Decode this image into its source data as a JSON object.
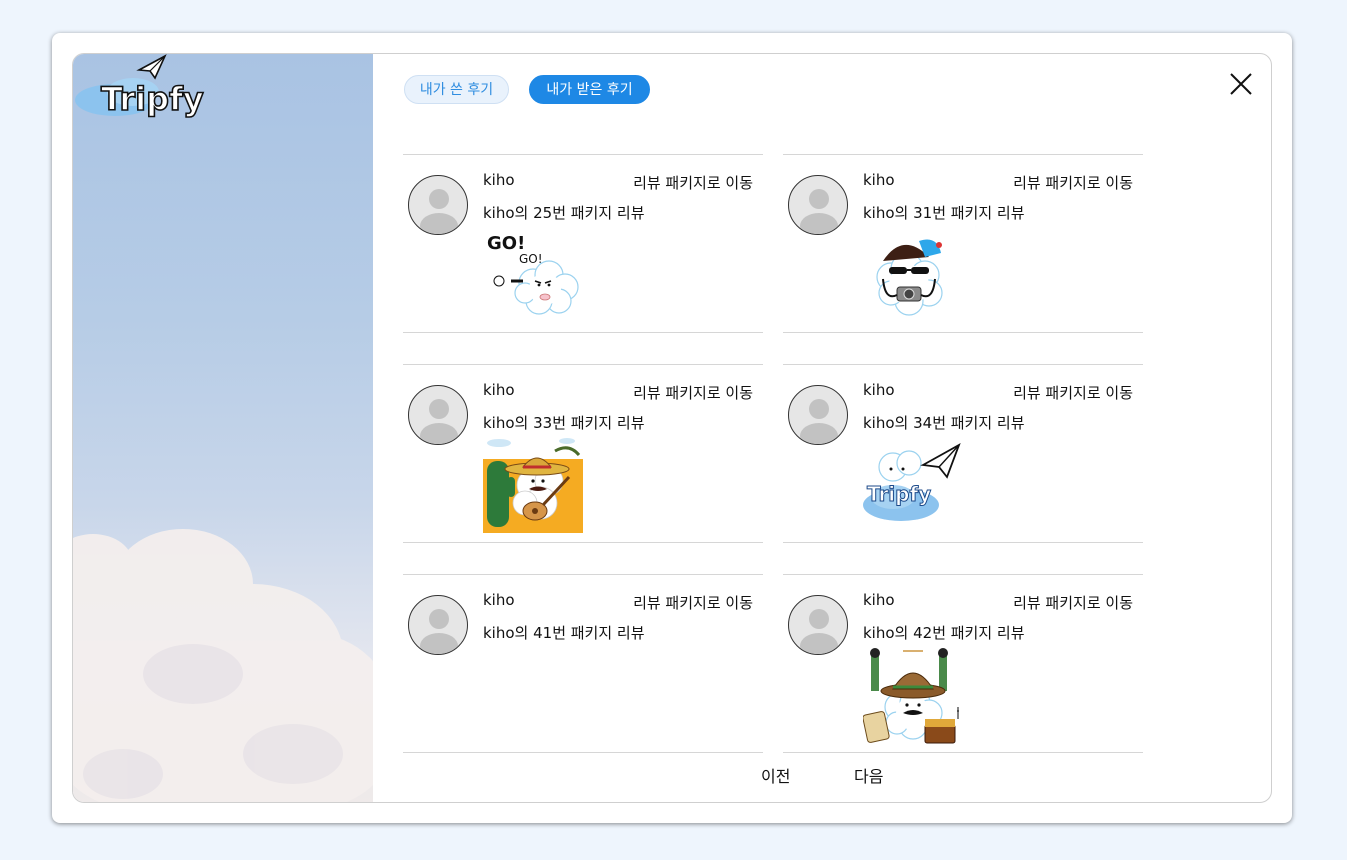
{
  "brand": {
    "logo_text": "Tripfy"
  },
  "tabs": {
    "written": "내가 쓴 후기",
    "received": "내가 받은 후기"
  },
  "reviews": [
    {
      "user": "kiho",
      "goto": "리뷰 패키지로 이동",
      "title": "kiho의 25번 패키지 리뷰",
      "sticker_text_1": "GO!",
      "sticker_text_2": "GO!"
    },
    {
      "user": "kiho",
      "goto": "리뷰 패키지로 이동",
      "title": "kiho의 31번 패키지 리뷰"
    },
    {
      "user": "kiho",
      "goto": "리뷰 패키지로 이동",
      "title": "kiho의 33번 패키지 리뷰"
    },
    {
      "user": "kiho",
      "goto": "리뷰 패키지로 이동",
      "title": "kiho의 34번 패키지 리뷰",
      "sticker_text": "Tripfy"
    },
    {
      "user": "kiho",
      "goto": "리뷰 패키지로 이동",
      "title": "kiho의 41번 패키지 리뷰"
    },
    {
      "user": "kiho",
      "goto": "리뷰 패키지로 이동",
      "title": "kiho의 42번 패키지 리뷰"
    }
  ],
  "pagination": {
    "prev": "이전",
    "next": "다음"
  }
}
